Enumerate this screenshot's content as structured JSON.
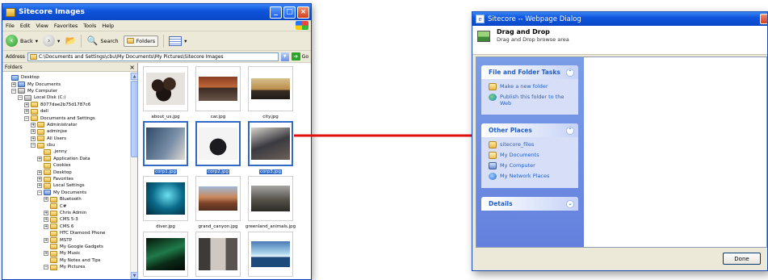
{
  "explorer": {
    "title": "Sitecore Images",
    "menu": [
      "File",
      "Edit",
      "View",
      "Favorites",
      "Tools",
      "Help"
    ],
    "toolbar": {
      "back": "Back",
      "search": "Search",
      "folders": "Folders"
    },
    "address_label": "Address",
    "address_value": "C:\\Documents and Settings\\cbu\\My Documents\\My Pictures\\Sitecore Images",
    "go_label": "Go",
    "folders_header": "Folders",
    "tree": [
      {
        "label": "Desktop",
        "indent": 0,
        "exp": "",
        "kind": "special"
      },
      {
        "label": "My Documents",
        "indent": 1,
        "exp": "+",
        "kind": "special"
      },
      {
        "label": "My Computer",
        "indent": 1,
        "exp": "−",
        "kind": "drive"
      },
      {
        "label": "Local Disk (C:)",
        "indent": 2,
        "exp": "−",
        "kind": "drive"
      },
      {
        "label": "8077dae2b75d1787c6",
        "indent": 3,
        "exp": "+",
        "kind": "folder"
      },
      {
        "label": "dell",
        "indent": 3,
        "exp": "+",
        "kind": "folder"
      },
      {
        "label": "Documents and Settings",
        "indent": 3,
        "exp": "−",
        "kind": "folder"
      },
      {
        "label": "Administrator",
        "indent": 4,
        "exp": "+",
        "kind": "folder"
      },
      {
        "label": "adminjse",
        "indent": 4,
        "exp": "+",
        "kind": "folder"
      },
      {
        "label": "All Users",
        "indent": 4,
        "exp": "+",
        "kind": "folder"
      },
      {
        "label": "cbu",
        "indent": 4,
        "exp": "−",
        "kind": "folder"
      },
      {
        "label": ".jenny",
        "indent": 5,
        "exp": "",
        "kind": "folder"
      },
      {
        "label": "Application Data",
        "indent": 5,
        "exp": "+",
        "kind": "folder"
      },
      {
        "label": "Cookies",
        "indent": 5,
        "exp": "",
        "kind": "folder"
      },
      {
        "label": "Desktop",
        "indent": 5,
        "exp": "+",
        "kind": "folder"
      },
      {
        "label": "Favorites",
        "indent": 5,
        "exp": "+",
        "kind": "folder"
      },
      {
        "label": "Local Settings",
        "indent": 5,
        "exp": "+",
        "kind": "folder"
      },
      {
        "label": "My Documents",
        "indent": 5,
        "exp": "−",
        "kind": "special"
      },
      {
        "label": "Bluetooth",
        "indent": 6,
        "exp": "+",
        "kind": "folder"
      },
      {
        "label": "C#",
        "indent": 6,
        "exp": "",
        "kind": "folder"
      },
      {
        "label": "Chris Admin",
        "indent": 6,
        "exp": "+",
        "kind": "folder"
      },
      {
        "label": "CMS 5-3",
        "indent": 6,
        "exp": "+",
        "kind": "folder"
      },
      {
        "label": "CMS 6",
        "indent": 6,
        "exp": "+",
        "kind": "folder"
      },
      {
        "label": "HTC Diamond Phone",
        "indent": 6,
        "exp": "",
        "kind": "folder"
      },
      {
        "label": "MSTP",
        "indent": 6,
        "exp": "+",
        "kind": "folder"
      },
      {
        "label": "My Google Gadgets",
        "indent": 6,
        "exp": "",
        "kind": "folder"
      },
      {
        "label": "My Music",
        "indent": 6,
        "exp": "+",
        "kind": "folder"
      },
      {
        "label": "My Notes and Tips",
        "indent": 6,
        "exp": "",
        "kind": "folder"
      },
      {
        "label": "My Pictures",
        "indent": 6,
        "exp": "−",
        "kind": "folder"
      }
    ],
    "thumbnails": [
      {
        "name": "about_us.jpg",
        "pic": "about",
        "selected": false
      },
      {
        "name": "car.jpg",
        "pic": "car",
        "selected": false
      },
      {
        "name": "city.jpg",
        "pic": "city",
        "selected": false
      },
      {
        "name": "corp1.jpg",
        "pic": "corp1",
        "selected": true
      },
      {
        "name": "corp2.jpg",
        "pic": "corp2",
        "selected": true
      },
      {
        "name": "corp3.jpg",
        "pic": "corp3",
        "selected": true
      },
      {
        "name": "diver.jpg",
        "pic": "diver",
        "selected": false
      },
      {
        "name": "grand_canyon.jpg",
        "pic": "canyon",
        "selected": false
      },
      {
        "name": "greenland_animals.jpg",
        "pic": "greenland",
        "selected": false
      },
      {
        "name": "",
        "pic": "aurora",
        "selected": false
      },
      {
        "name": "",
        "pic": "building",
        "selected": false
      },
      {
        "name": "",
        "pic": "iceberg",
        "selected": false
      }
    ]
  },
  "arrow_color": "#e01010",
  "dialog": {
    "title": "Sitecore -- Webpage Dialog",
    "header_title": "Drag and Drop",
    "header_subtitle": "Drag and Drop browse area",
    "sections": [
      {
        "title": "File and Folder Tasks",
        "chevron": "⌃",
        "items": [
          {
            "label": "Make a new folder",
            "icon": "newfolder"
          },
          {
            "label": "Publish this folder to the Web",
            "icon": "web"
          }
        ]
      },
      {
        "title": "Other Places",
        "chevron": "⌃",
        "items": [
          {
            "label": "sitecore_files",
            "icon": "folder"
          },
          {
            "label": "My Documents",
            "icon": "mydocs"
          },
          {
            "label": "My Computer",
            "icon": "mycomputer"
          },
          {
            "label": "My Network Places",
            "icon": "network"
          }
        ]
      },
      {
        "title": "Details",
        "chevron": "⌄",
        "items": []
      }
    ],
    "done_label": "Done"
  }
}
